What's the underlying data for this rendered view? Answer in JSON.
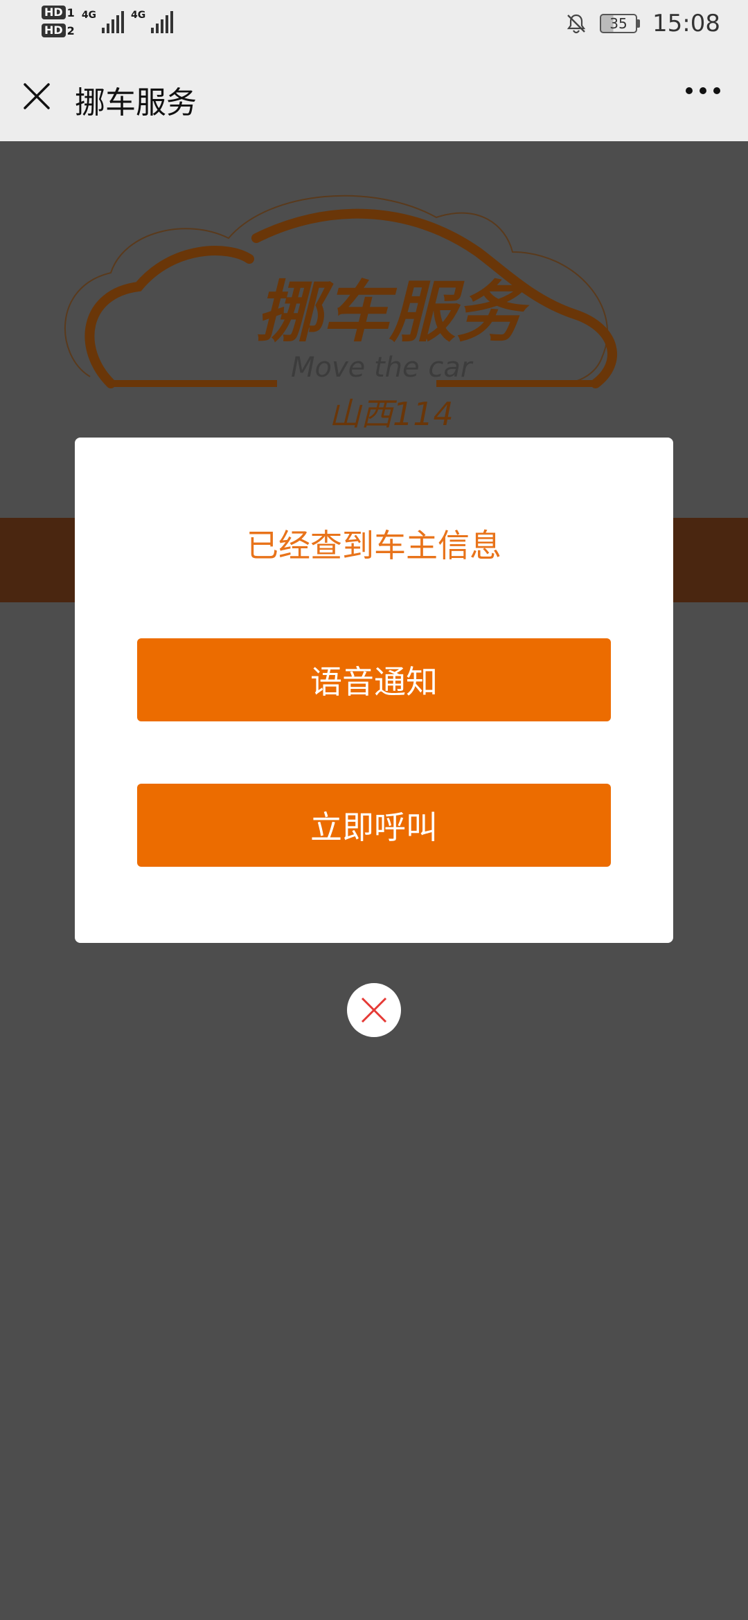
{
  "status_bar": {
    "hd1": "HD",
    "hd1_sub": "1",
    "hd2": "HD",
    "hd2_sub": "2",
    "net1": "4G",
    "net2": "4G",
    "battery": "35",
    "time": "15:08"
  },
  "title_bar": {
    "title": "挪车服务"
  },
  "logo": {
    "main_text": "挪车服务",
    "sub_text": "Move the car",
    "region_text": "山西114"
  },
  "dialog": {
    "message": "已经查到车主信息",
    "voice_button": "语音通知",
    "call_button": "立即呼叫"
  },
  "colors": {
    "accent": "#ec6c00",
    "message_text": "#e8731a",
    "overlay": "#4d4d4d"
  },
  "icons": {
    "close": "close-icon",
    "more": "more-icon",
    "dismiss": "dismiss-x-icon"
  }
}
